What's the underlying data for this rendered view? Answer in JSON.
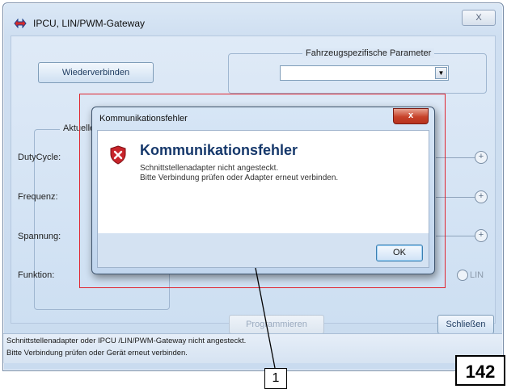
{
  "window": {
    "title": "IPCU, LIN/PWM-Gateway",
    "close_glyph": "X"
  },
  "main": {
    "reconnect_label": "Wiederverbinden",
    "vehicle_params_title": "Fahrzeugspezifische Parameter",
    "vehicle_params_value": "",
    "current_group_title": "Aktuelle",
    "dutycycle_label": "DutyCycle:",
    "frequency_label": "Frequenz:",
    "voltage_label": "Spannung:",
    "function_label": "Funktion:",
    "lin_label": "LIN",
    "program_label": "Programmieren",
    "close_label": "Schließen"
  },
  "status": {
    "line1": "Schnittstellenadapter oder IPCU /LIN/PWM-Gateway nicht angesteckt.",
    "line2": "Bitte Verbindung prüfen oder Gerät erneut verbinden."
  },
  "dialog": {
    "title": "Kommunikationsfehler",
    "close_glyph": "x",
    "heading": "Kommunikationsfehler",
    "message_line1": "Schnittstellenadapter nicht angesteckt.",
    "message_line2": "Bitte Verbindung prüfen oder Adapter erneut verbinden.",
    "ok_label": "OK"
  },
  "annotations": {
    "callout_number": "1",
    "page_number": "142"
  },
  "colors": {
    "highlight": "#e0242e",
    "dialog_heading": "#16386b",
    "dialog_close": "#c7422a"
  }
}
